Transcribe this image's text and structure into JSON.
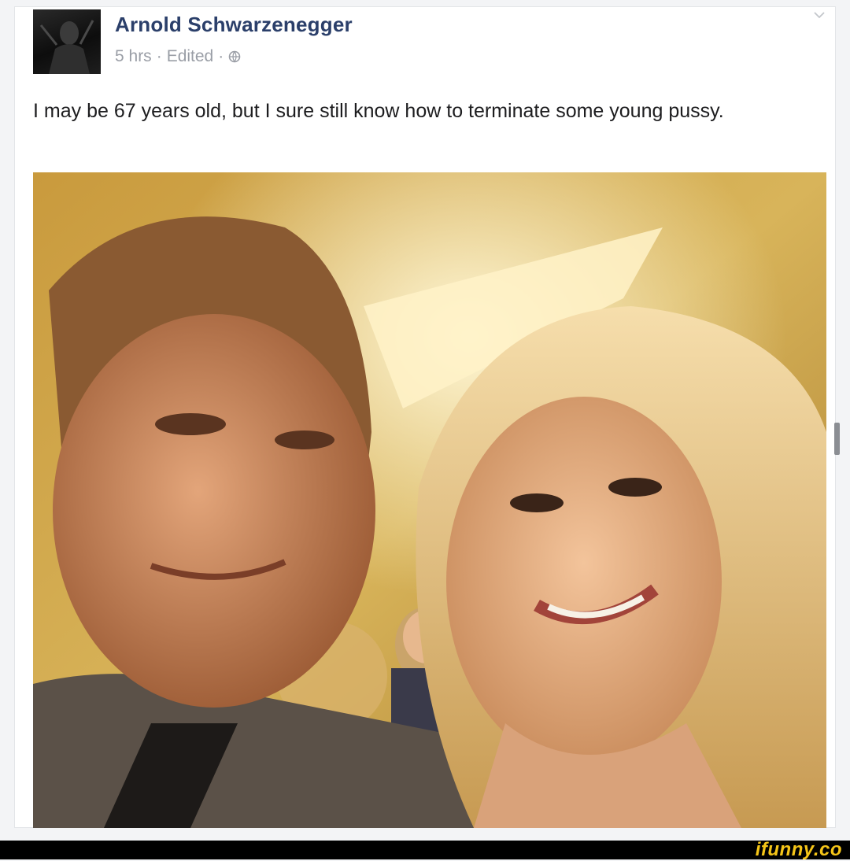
{
  "post": {
    "author": "Arnold Schwarzenegger",
    "time": "5 hrs",
    "edited": "Edited",
    "separator": "·",
    "status_text": "I may be 67 years old, but I sure still know how to terminate some young pussy."
  },
  "icons": {
    "audience": "globe-icon",
    "menu": "chevron-down-icon"
  },
  "watermark": "ifunny.co",
  "colors": {
    "author": "#2b3f6a",
    "meta": "#9a9ea6",
    "watermark": "#f5c518"
  }
}
